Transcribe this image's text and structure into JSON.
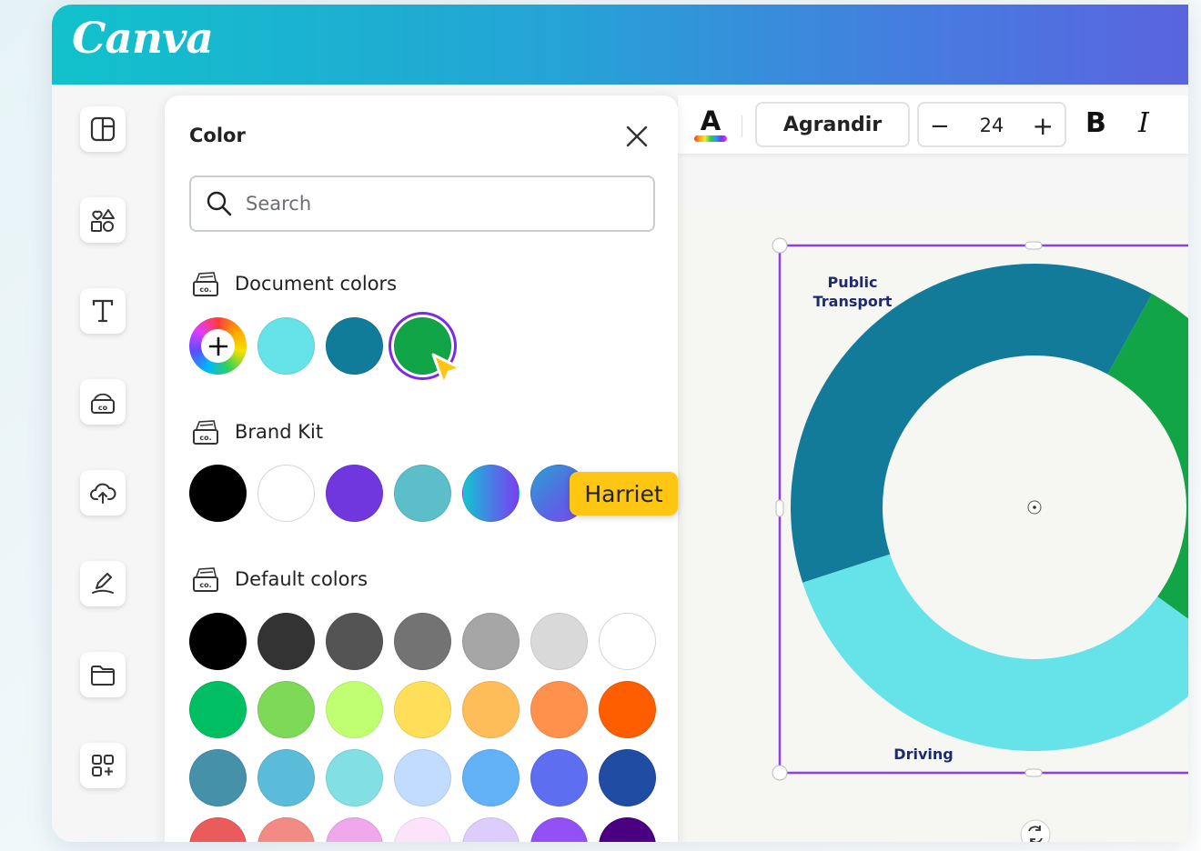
{
  "app": {
    "logo": "Canva"
  },
  "sidebar": {
    "items": [
      {
        "name": "design-icon"
      },
      {
        "name": "elements-icon"
      },
      {
        "name": "text-icon"
      },
      {
        "name": "brand-icon"
      },
      {
        "name": "uploads-icon"
      },
      {
        "name": "draw-icon"
      },
      {
        "name": "projects-icon"
      },
      {
        "name": "apps-icon"
      }
    ]
  },
  "color_panel": {
    "title": "Color",
    "search_placeholder": "Search",
    "document_colors": {
      "label": "Document colors",
      "swatches": [
        "#66e3e8",
        "#117b9a",
        "#12a548"
      ],
      "selected": "#12a548"
    },
    "brand_kit": {
      "label": "Brand Kit",
      "swatches": [
        "#000000",
        "#ffffff",
        "#7137df",
        "#5cbec9",
        "gradient-teal-purple",
        "gradient-blue-purple"
      ]
    },
    "default_colors": {
      "label": "Default colors",
      "rows": [
        [
          "#000000",
          "#333333",
          "#545454",
          "#737373",
          "#a6a6a6",
          "#d9d9d9",
          "#ffffff"
        ],
        [
          "#00bf63",
          "#7ed957",
          "#c1ff72",
          "#ffde59",
          "#ffbd59",
          "#ff914d",
          "#ff5e00"
        ],
        [
          "#4591a9",
          "#5bbcd9",
          "#82e0e4",
          "#c2dcff",
          "#63b2f7",
          "#5d6ff0",
          "#204ca3"
        ],
        [
          "#ec5b5b",
          "#f28b84",
          "#f0a8ec",
          "#fce3fa",
          "#dccdfc",
          "#9350f5",
          "#4b0082"
        ]
      ]
    }
  },
  "cursor": {
    "user_name": "Harriet"
  },
  "toolbar": {
    "text_color_label": "A",
    "font_name": "Agrandir",
    "font_size": "24",
    "decrease_label": "−",
    "increase_label": "+",
    "bold_label": "B",
    "italic_label": "I"
  },
  "chart_data": {
    "type": "pie",
    "labels": [
      "Public Transport",
      "",
      "Driving"
    ],
    "values": [
      38,
      27,
      35
    ],
    "colors": [
      "#127b9a",
      "#12a548",
      "#66e3e8"
    ],
    "donut": true
  }
}
